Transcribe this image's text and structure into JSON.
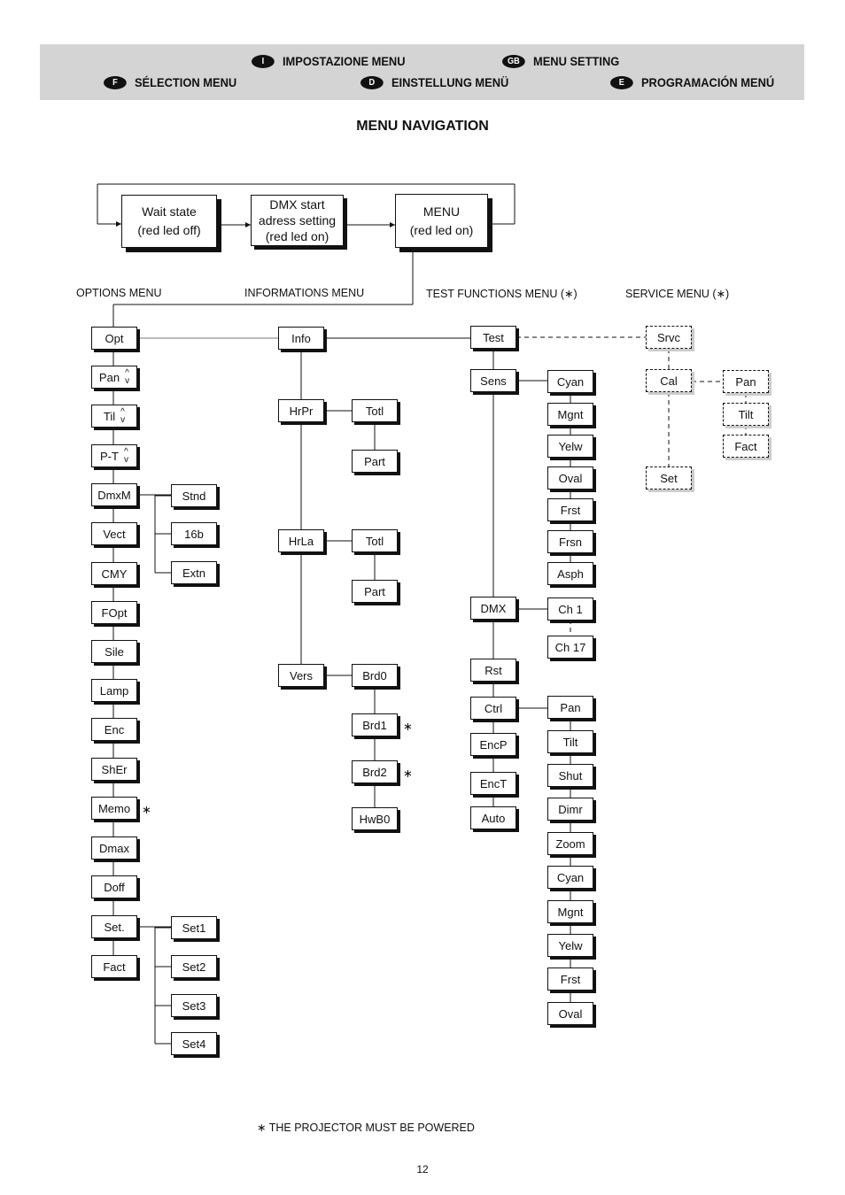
{
  "header": {
    "languages": [
      {
        "code": "I",
        "label": "IMPOSTAZIONE MENU"
      },
      {
        "code": "GB",
        "label": "MENU SETTING"
      },
      {
        "code": "F",
        "label": "SÉLECTION MENU"
      },
      {
        "code": "D",
        "label": "EINSTELLUNG MENÜ"
      },
      {
        "code": "E",
        "label": "PROGRAMACIÓN MENÚ"
      }
    ]
  },
  "title": "MENU NAVIGATION",
  "states": [
    {
      "line1": "Wait state",
      "line2": "(red led off)"
    },
    {
      "line1": "DMX start",
      "line2": "adress setting",
      "line3": "(red led on)"
    },
    {
      "line1": "MENU",
      "line2": "(red led on)"
    }
  ],
  "sections": {
    "options": "OPTIONS MENU",
    "informations": "INFORMATIONS MENU",
    "test": "TEST FUNCTIONS MENU (∗)",
    "service": "SERVICE MENU (∗)"
  },
  "options": [
    "Opt",
    "Pan",
    "Til",
    "P-T",
    "DmxM",
    "Vect",
    "CMY",
    "FOpt",
    "Sile",
    "Lamp",
    "Enc",
    "ShEr",
    "Memo",
    "Dmax",
    "Doff",
    "Set.",
    "Fact"
  ],
  "dmxm_sub": [
    "Stnd",
    "16b",
    "Extn"
  ],
  "set_sub": [
    "Set1",
    "Set2",
    "Set3",
    "Set4"
  ],
  "info": [
    "Info",
    "HrPr",
    "HrLa",
    "Vers"
  ],
  "info_sub": [
    "Totl",
    "Part",
    "Totl",
    "Part",
    "Brd0",
    "Brd1",
    "Brd2",
    "HwB0"
  ],
  "test": [
    "Test",
    "Sens",
    "DMX",
    "Rst",
    "Ctrl",
    "EncP",
    "EncT",
    "Auto"
  ],
  "sens_sub": [
    "Cyan",
    "Mgnt",
    "Yelw",
    "Oval",
    "Frst",
    "Frsn",
    "Asph"
  ],
  "dmx_sub": [
    "Ch 1",
    "Ch 17"
  ],
  "ctrl_sub": [
    "Pan",
    "Tilt",
    "Shut",
    "Dimr",
    "Zoom",
    "Cyan",
    "Mgnt",
    "Yelw",
    "Frst",
    "Oval"
  ],
  "service": [
    "Srvc",
    "Cal",
    "Set"
  ],
  "cal_sub": [
    "Pan",
    "Tilt",
    "Fact"
  ],
  "star_symbol": "∗",
  "footnote": "∗ THE PROJECTOR MUST BE POWERED",
  "page_number": "12"
}
